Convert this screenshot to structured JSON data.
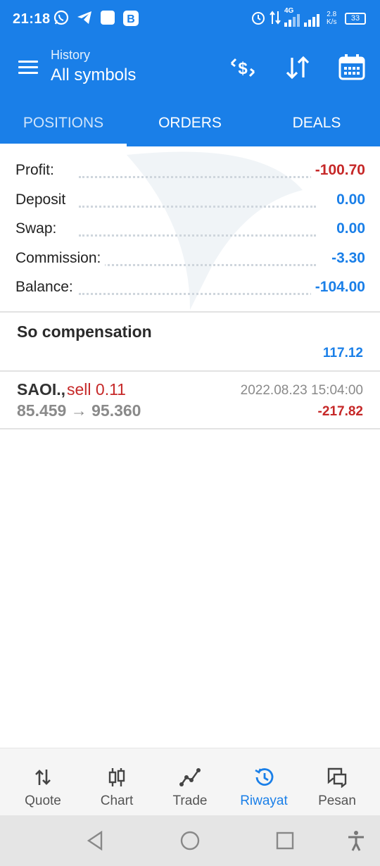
{
  "status_bar": {
    "time": "21:18",
    "network": "4G",
    "speed": "2.8",
    "speed_unit": "K/s",
    "battery": "33"
  },
  "app_bar": {
    "subtitle": "History",
    "title": "All symbols",
    "icons": [
      "menu-icon",
      "dollar-exchange-icon",
      "sort-icon",
      "calendar-icon"
    ]
  },
  "tabs": [
    {
      "label": "POSITIONS",
      "active": true
    },
    {
      "label": "ORDERS",
      "active": false
    },
    {
      "label": "DEALS",
      "active": false
    }
  ],
  "summary": [
    {
      "label": "Profit:",
      "value": "-100.70",
      "color": "#c62828"
    },
    {
      "label": "Deposit",
      "value": "0.00",
      "color": "#1a7fe8"
    },
    {
      "label": "Swap:",
      "value": "0.00",
      "color": "#1a7fe8"
    },
    {
      "label": "Commission:",
      "value": "-3.30",
      "color": "#1a7fe8"
    },
    {
      "label": "Balance:",
      "value": "-104.00",
      "color": "#1a7fe8"
    }
  ],
  "compensation": {
    "name": "So compensation",
    "amount": "117.12"
  },
  "deal": {
    "symbol": "SAOI.,",
    "side": "sell 0.11",
    "prices": "85.459 → 95.360",
    "date": "2022.08.23 15:04:00",
    "profit": "-217.82"
  },
  "bottom_nav": [
    {
      "label": "Quote",
      "icon": "quote-arrows-icon",
      "active": false
    },
    {
      "label": "Chart",
      "icon": "candlestick-chart-icon",
      "active": false
    },
    {
      "label": "Trade",
      "icon": "trade-line-icon",
      "active": false
    },
    {
      "label": "Riwayat",
      "icon": "history-clock-icon",
      "active": true
    },
    {
      "label": "Pesan",
      "icon": "messages-icon",
      "active": false
    }
  ],
  "colors": {
    "primary": "#1a7fe8",
    "negative": "#c62828",
    "muted": "#8a8a8a"
  }
}
